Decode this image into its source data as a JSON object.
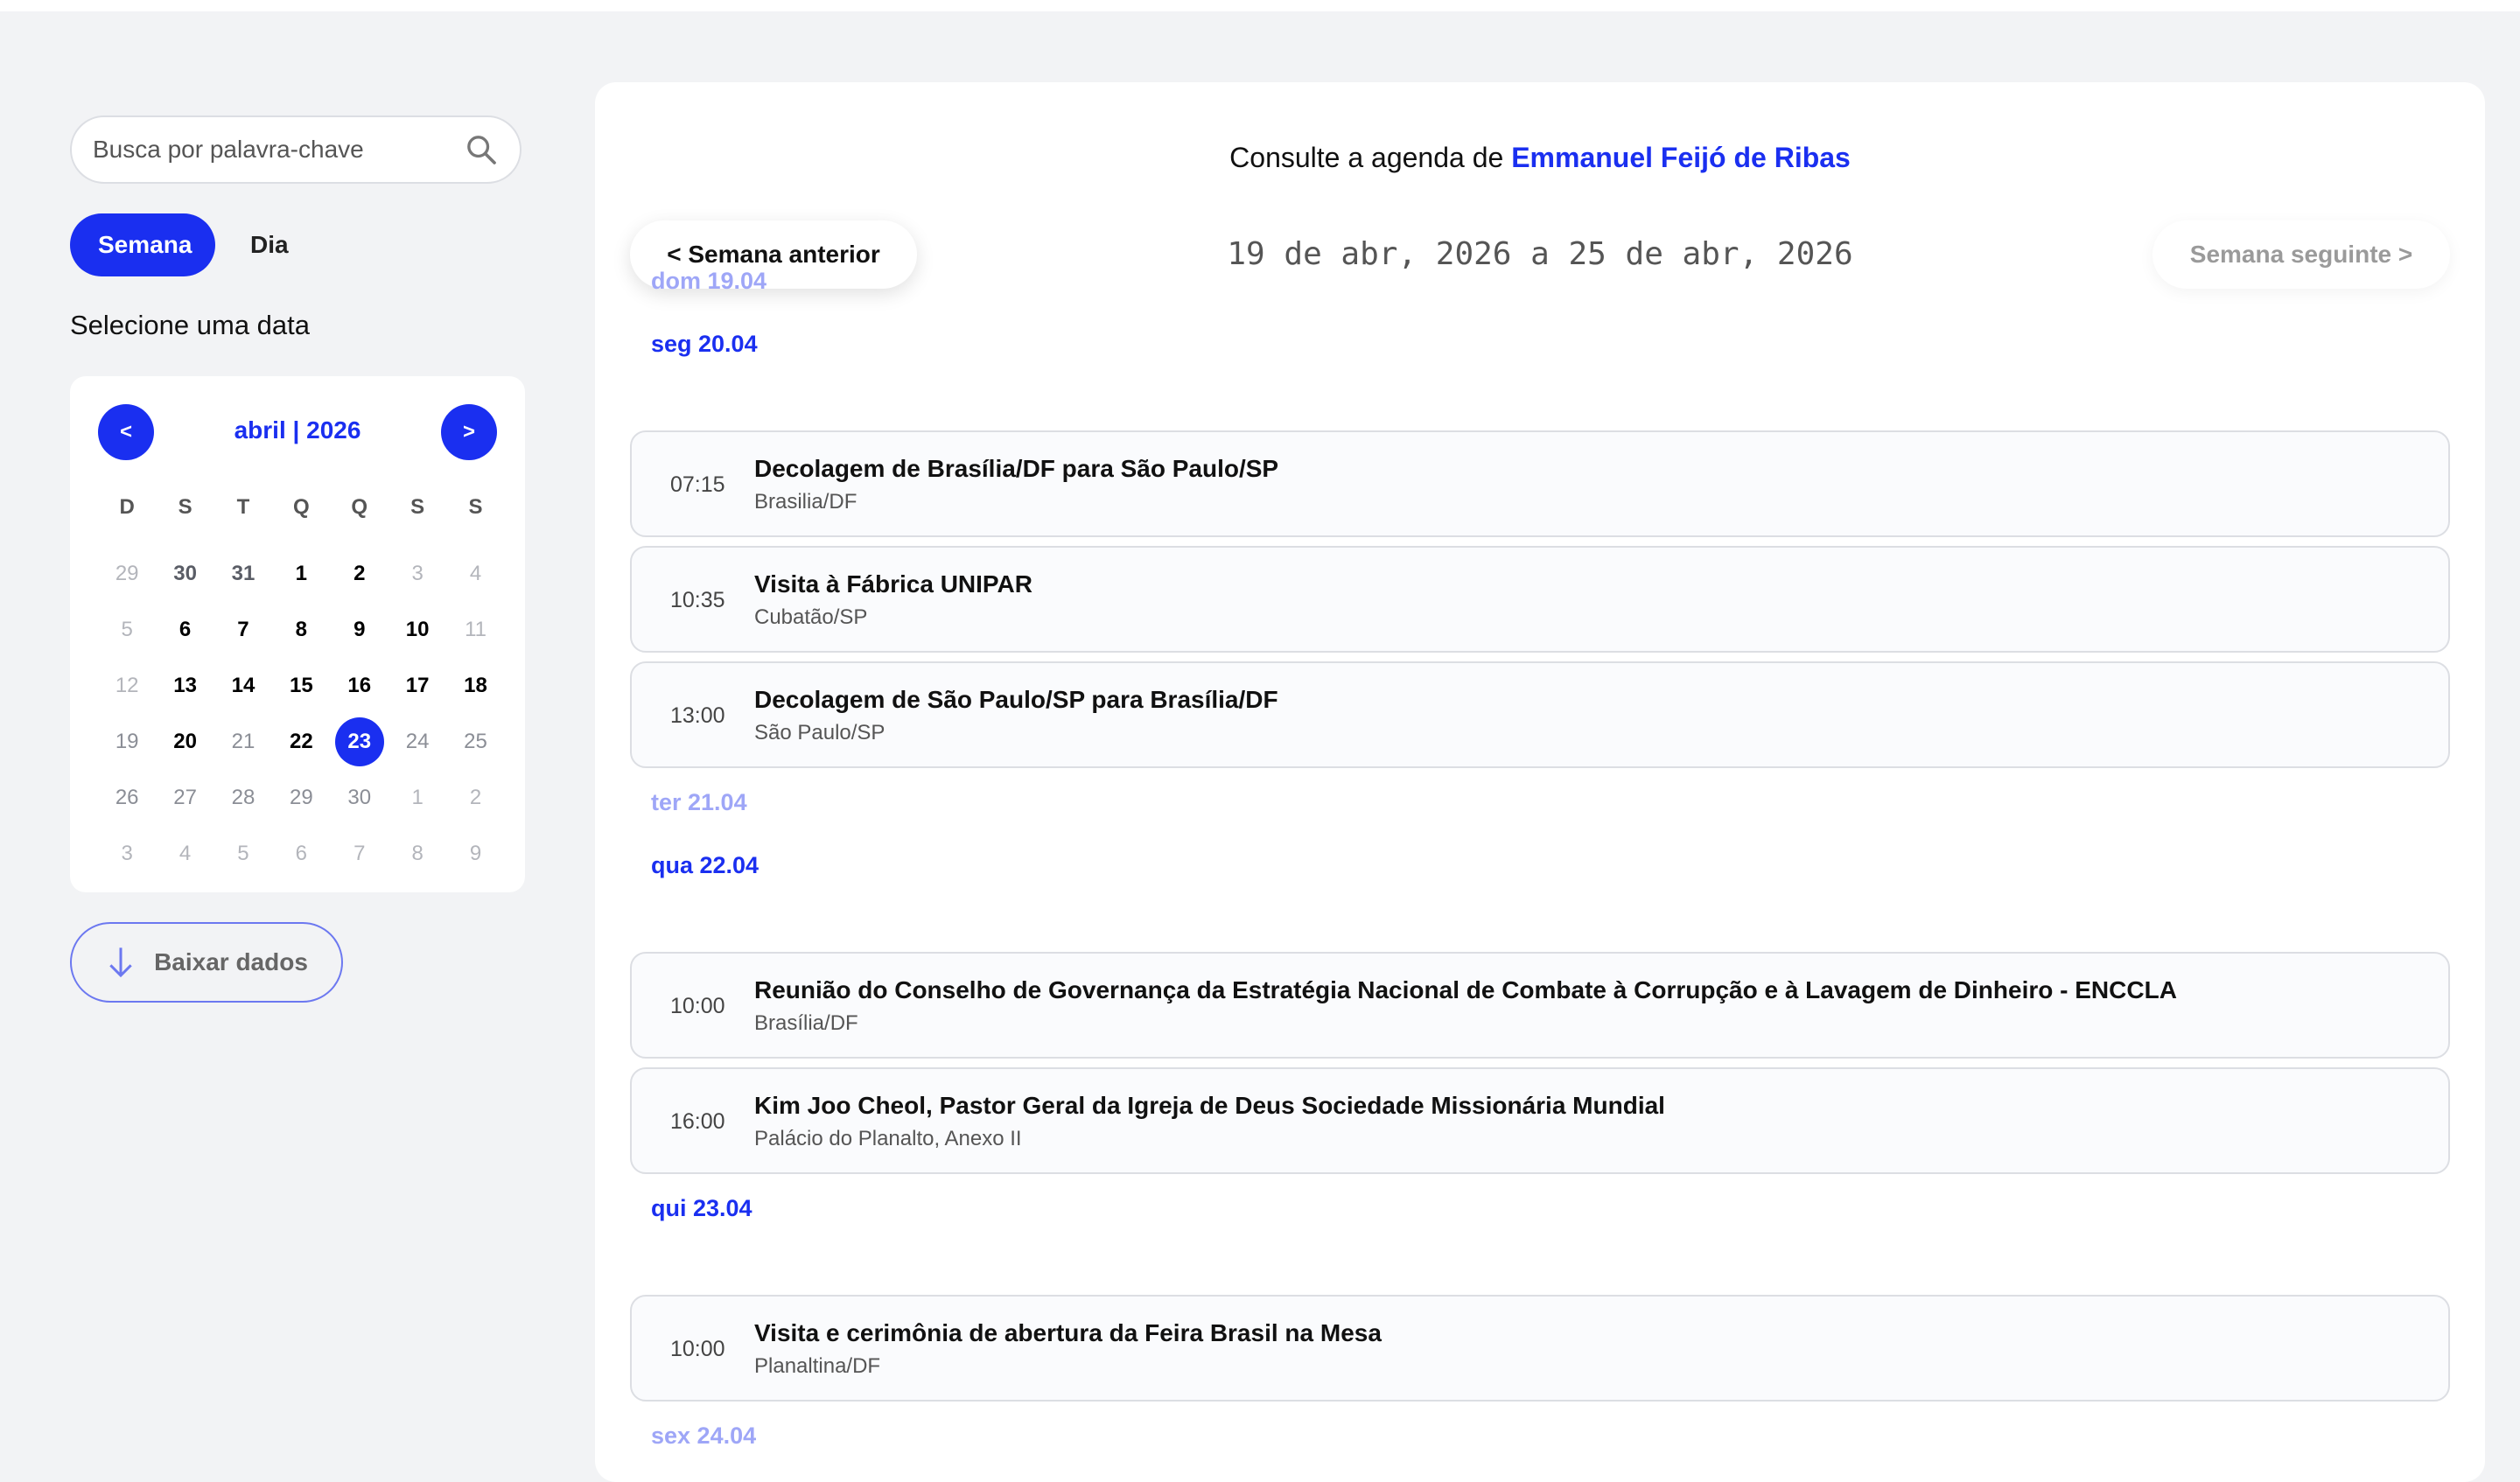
{
  "sidebar": {
    "search_placeholder": "Busca por palavra-chave",
    "view_week": "Semana",
    "view_day": "Dia",
    "select_label": "Selecione uma data",
    "download_label": "Baixar dados"
  },
  "calendar": {
    "title": "abril | 2026",
    "prev": "<",
    "next": ">",
    "weekdays": [
      "D",
      "S",
      "T",
      "Q",
      "Q",
      "S",
      "S"
    ],
    "weeks": [
      [
        {
          "d": "29",
          "s": "dim"
        },
        {
          "d": "30",
          "s": "past"
        },
        {
          "d": "31",
          "s": "past"
        },
        {
          "d": "1",
          "s": "bold"
        },
        {
          "d": "2",
          "s": "bold"
        },
        {
          "d": "3",
          "s": "dim"
        },
        {
          "d": "4",
          "s": "dim"
        }
      ],
      [
        {
          "d": "5",
          "s": "dim"
        },
        {
          "d": "6",
          "s": "bold"
        },
        {
          "d": "7",
          "s": "bold"
        },
        {
          "d": "8",
          "s": "bold"
        },
        {
          "d": "9",
          "s": "bold"
        },
        {
          "d": "10",
          "s": "bold"
        },
        {
          "d": "11",
          "s": "dim"
        }
      ],
      [
        {
          "d": "12",
          "s": "dim"
        },
        {
          "d": "13",
          "s": "bold"
        },
        {
          "d": "14",
          "s": "bold"
        },
        {
          "d": "15",
          "s": "bold"
        },
        {
          "d": "16",
          "s": "bold"
        },
        {
          "d": "17",
          "s": "bold"
        },
        {
          "d": "18",
          "s": "bold"
        }
      ],
      [
        {
          "d": "19",
          "s": "muted"
        },
        {
          "d": "20",
          "s": "bold"
        },
        {
          "d": "21",
          "s": "muted"
        },
        {
          "d": "22",
          "s": "bold"
        },
        {
          "d": "23",
          "s": "selected"
        },
        {
          "d": "24",
          "s": "muted"
        },
        {
          "d": "25",
          "s": "muted"
        }
      ],
      [
        {
          "d": "26",
          "s": "muted"
        },
        {
          "d": "27",
          "s": "muted"
        },
        {
          "d": "28",
          "s": "muted"
        },
        {
          "d": "29",
          "s": "muted"
        },
        {
          "d": "30",
          "s": "muted"
        },
        {
          "d": "1",
          "s": "dim"
        },
        {
          "d": "2",
          "s": "dim"
        }
      ],
      [
        {
          "d": "3",
          "s": "dim"
        },
        {
          "d": "4",
          "s": "dim"
        },
        {
          "d": "5",
          "s": "dim"
        },
        {
          "d": "6",
          "s": "dim"
        },
        {
          "d": "7",
          "s": "dim"
        },
        {
          "d": "8",
          "s": "dim"
        },
        {
          "d": "9",
          "s": "dim"
        }
      ]
    ]
  },
  "header": {
    "prefix": "Consulte a agenda de",
    "name": "Emmanuel Feijó de Ribas"
  },
  "week_nav": {
    "prev": "< Semana anterior",
    "range": "19 de abr, 2026 a 25 de abr, 2026",
    "next": "Semana seguinte >"
  },
  "days": [
    {
      "label": "dom 19.04",
      "events": []
    },
    {
      "label": "seg 20.04",
      "events": [
        {
          "time": "07:15",
          "title": "Decolagem de Brasília/DF para São Paulo/SP",
          "place": "Brasilia/DF"
        },
        {
          "time": "10:35",
          "title": "Visita à Fábrica UNIPAR",
          "place": "Cubatão/SP"
        },
        {
          "time": "13:00",
          "title": "Decolagem de São Paulo/SP para Brasília/DF",
          "place": "São Paulo/SP"
        }
      ]
    },
    {
      "label": "ter 21.04",
      "events": []
    },
    {
      "label": "qua 22.04",
      "events": [
        {
          "time": "10:00",
          "title": "Reunião do Conselho de Governança da Estratégia Nacional de Combate à Corrupção e à Lavagem de Dinheiro - ENCCLA",
          "place": "Brasília/DF"
        },
        {
          "time": "16:00",
          "title": "Kim Joo Cheol, Pastor Geral da Igreja de Deus Sociedade Missionária Mundial",
          "place": "Palácio do Planalto, Anexo II"
        }
      ]
    },
    {
      "label": "qui 23.04",
      "events": [
        {
          "time": "10:00",
          "title": "Visita e cerimônia de abertura da Feira Brasil na Mesa",
          "place": "Planaltina/DF"
        }
      ]
    },
    {
      "label": "sex 24.04",
      "events": []
    }
  ],
  "colors": {
    "accent": "#1a2ff0",
    "accent_light": "#9ea6f7",
    "background": "#f2f3f5"
  },
  "icons": {
    "search": "search-icon",
    "download": "arrow-down-icon"
  }
}
